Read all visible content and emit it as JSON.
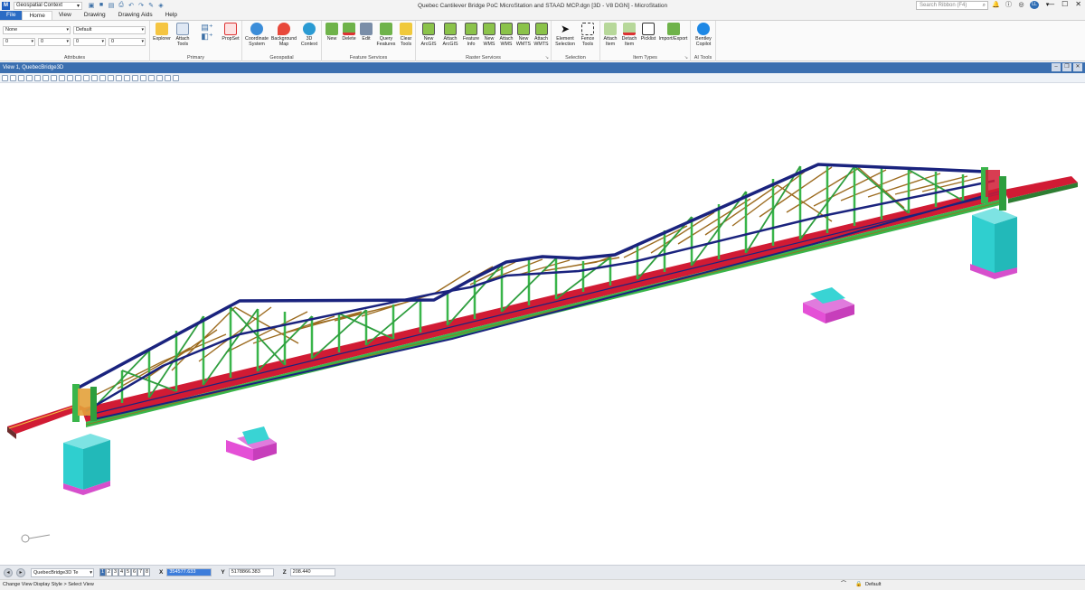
{
  "app": {
    "title": "Quebec Cantilever Bridge PoC MicroStation and STAAD MCP.dgn [3D - V8 DGN] - MicroStation",
    "workflow": "Geospatial Context",
    "search_placeholder": "Search Ribbon (F4)",
    "user_initials": "LL"
  },
  "tabs": [
    "File",
    "Home",
    "View",
    "Drawing",
    "Drawing Aids",
    "Help"
  ],
  "ribbon": {
    "attributes": {
      "label": "Attributes",
      "level": "None",
      "template": "Default",
      "color": "0",
      "style": "0",
      "weight": "0",
      "transparency": "0"
    },
    "primary": {
      "label": "Primary",
      "buttons": [
        "Explorer",
        "Attach Tools",
        "PropSet"
      ]
    },
    "geospatial": {
      "label": "Geospatial",
      "buttons": [
        "Coordinate System",
        "Background Map",
        "3D Context"
      ]
    },
    "feature_services": {
      "label": "Feature Services",
      "buttons": [
        "New",
        "Delete",
        "Edit",
        "Query Features",
        "Clear Tools"
      ]
    },
    "raster_services": {
      "label": "Raster Services",
      "buttons": [
        "New ArcGIS",
        "Attach ArcGIS",
        "Feature Info",
        "New WMS",
        "Attach WMS",
        "New WMTS",
        "Attach WMTS"
      ]
    },
    "selection": {
      "label": "Selection",
      "buttons": [
        "Element Selection",
        "Fence Tools"
      ]
    },
    "item_types": {
      "label": "Item Types",
      "buttons": [
        "Attach Item",
        "Detach Item",
        "Picklist",
        "Import/Export"
      ]
    },
    "ai_tools": {
      "label": "AI Tools",
      "buttons": [
        "Bentley Copilot"
      ]
    }
  },
  "view": {
    "title": "View 1, QuebecBridge3D"
  },
  "bottom": {
    "model": "QuebecBridge3D Te",
    "view_numbers": [
      "1",
      "2",
      "3",
      "4",
      "5",
      "6",
      "7",
      "8"
    ],
    "x_label": "X",
    "x_value": "354577.633",
    "y_label": "Y",
    "y_value": "5178866.383",
    "z_label": "Z",
    "z_value": "208.440"
  },
  "status": {
    "prompt": "Change View Display Style > Select View",
    "level": "Default"
  },
  "colors": {
    "chord": "#1a237e",
    "web": "#39b54a",
    "brace": "#9c6b1f",
    "deck": "#d11b34",
    "pier": "#39d4d4",
    "base": "#e34fd6",
    "accent": "#2b6cc4"
  }
}
